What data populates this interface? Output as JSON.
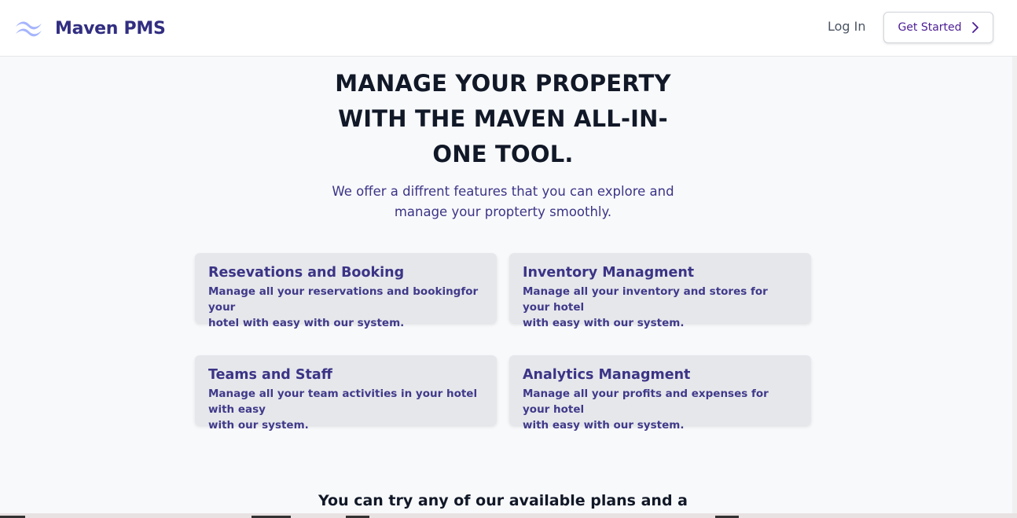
{
  "header": {
    "brand": "Maven PMS",
    "login_label": "Log In",
    "cta_label": "Get Started"
  },
  "hero": {
    "title_line1": "MANAGE YOUR PROPERTY",
    "title_line2": "WITH THE MAVEN ALL-IN-",
    "title_line3": "ONE TOOL.",
    "subtitle_line1": "We offer a diffrent features that you can explore and",
    "subtitle_line2": "manage your propterty smoothly."
  },
  "features": [
    {
      "title": "Resevations and Booking",
      "desc_line1": "Manage all your reservations and bookingfor your",
      "desc_line2": "hotel with easy with our system."
    },
    {
      "title": "Inventory Managment",
      "desc_line1": "Manage all your inventory and stores for your hotel",
      "desc_line2": "with easy with our system."
    },
    {
      "title": "Teams and Staff",
      "desc_line1": "Manage all your team activities in your hotel with easy",
      "desc_line2": "with our system."
    },
    {
      "title": "Analytics Managment",
      "desc_line1": "Manage all your profits and expenses for your hotel",
      "desc_line2": "with easy with our system."
    }
  ],
  "plans": {
    "heading": "You can try any of our available plans and a"
  },
  "icons": {
    "logo": "waves-logo-icon",
    "cta": "chevron-right-icon"
  },
  "colors": {
    "brand": "#312e81",
    "logo_wave": "#a5b4fc",
    "card_bg": "#e6e7eb",
    "page_bg": "#f8f9fb"
  }
}
